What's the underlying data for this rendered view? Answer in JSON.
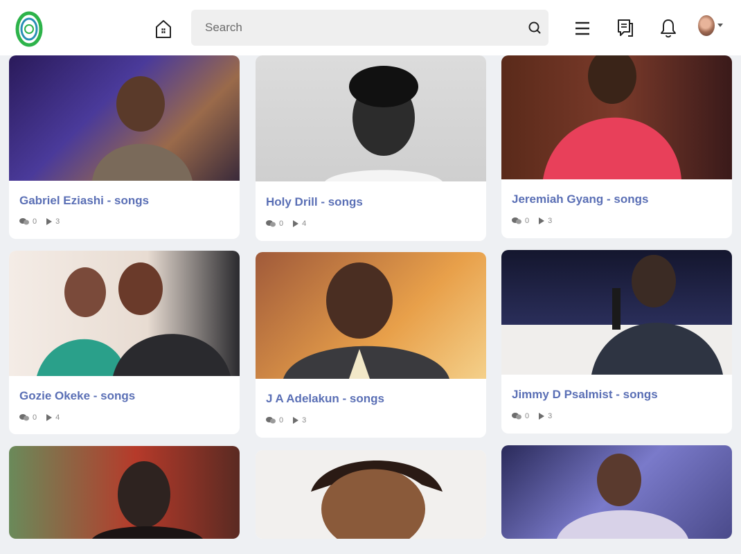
{
  "header": {
    "search_placeholder": "Search",
    "logo_label": "C"
  },
  "cards": [
    {
      "title": "Gabriel Eziashi - songs",
      "comments": "0",
      "plays": "3",
      "photo_bg": "#3a2a6e",
      "photo_fg": "#8a6a50"
    },
    {
      "title": "Holy Drill - songs",
      "comments": "0",
      "plays": "4",
      "photo_bg": "#d9d9d9",
      "photo_fg": "#2b2b2b"
    },
    {
      "title": "Jeremiah Gyang - songs",
      "comments": "0",
      "plays": "3",
      "photo_bg": "#6b2a1e",
      "photo_fg": "#e8405a"
    },
    {
      "title": "Gozie Okeke - songs",
      "comments": "0",
      "plays": "4",
      "photo_bg": "#f0e6e0",
      "photo_fg": "#3a2a2a"
    },
    {
      "title": "J A Adelakun - songs",
      "comments": "0",
      "plays": "3",
      "photo_bg": "#c97a3a",
      "photo_fg": "#4a2e22"
    },
    {
      "title": "Jimmy D Psalmist - songs",
      "comments": "0",
      "plays": "3",
      "photo_bg": "#1a1d3a",
      "photo_fg": "#3b2b24"
    },
    {
      "title": "",
      "comments": "",
      "plays": "",
      "photo_bg": "#b63a2a",
      "photo_fg": "#2e2320"
    },
    {
      "title": "",
      "comments": "",
      "plays": "",
      "photo_bg": "#f2f0ee",
      "photo_fg": "#5a3a2a"
    },
    {
      "title": "",
      "comments": "",
      "plays": "",
      "photo_bg": "#4a4a8a",
      "photo_fg": "#d8d2e8"
    }
  ],
  "colors": {
    "title": "#5a6fb5",
    "accent_green": "#2db34a",
    "page_bg": "#eef0f3"
  }
}
